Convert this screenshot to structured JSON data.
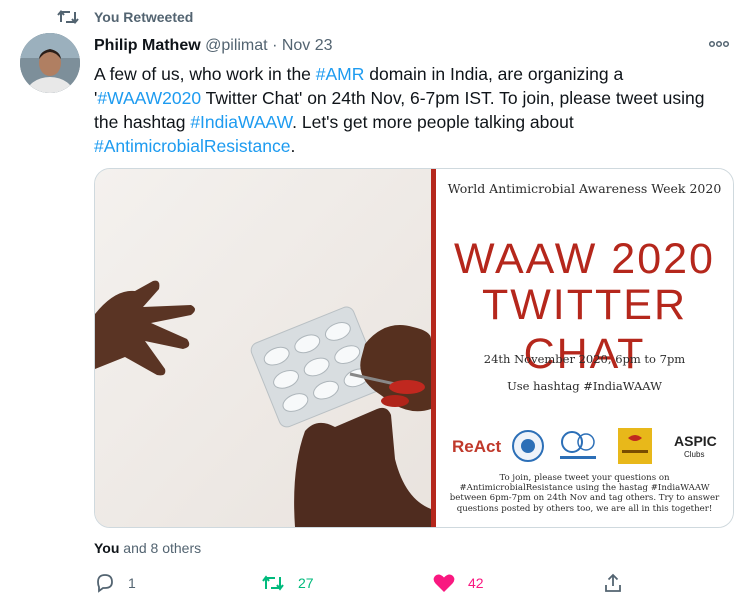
{
  "retweet_banner": {
    "icon": "retweet-icon",
    "label": "You Retweeted"
  },
  "tweet": {
    "author_name": "Philip Mathew",
    "handle": "@pilimat",
    "separator": "·",
    "date": "Nov 23",
    "text_parts": [
      {
        "text": "A few of us, who work in the ",
        "tag": false
      },
      {
        "text": "#AMR",
        "tag": true
      },
      {
        "text": " domain in India, are organizing a '",
        "tag": false
      },
      {
        "text": "#WAAW2020",
        "tag": true
      },
      {
        "text": " Twitter Chat' on 24th Nov, 6-7pm IST. To join, please tweet using the hashtag ",
        "tag": false
      },
      {
        "text": "#IndiaWAAW",
        "tag": true
      },
      {
        "text": ". Let's get more people talking about ",
        "tag": false
      },
      {
        "text": "#AntimicrobialResistance",
        "tag": true
      },
      {
        "text": ".",
        "tag": false
      }
    ]
  },
  "poster": {
    "title": "World Antimicrobial Awareness Week 2020",
    "big_line1": "WAAW 2020",
    "big_line2": "TWITTER CHAT",
    "date_line": "24th November 2020, 6pm to 7pm",
    "hashtag_line": "Use hashtag #IndiaWAAW",
    "logos": [
      {
        "name": "ReAct",
        "color": "#c0392b"
      },
      {
        "name": "e-Bug",
        "color": "#2c6fb7"
      },
      {
        "name": "Health & Hygiene",
        "color": "#2c6fb7"
      },
      {
        "name": "Biodiversity",
        "color": "#e8b81a"
      },
      {
        "name": "ASPIC",
        "color": "#222222"
      }
    ],
    "join_text": "To join, please tweet your questions on #AntimicrobialResistance using the hastag #IndiaWAAW between 6pm-7pm on 24th Nov and tag others. Try to answer questions posted by others too, we are all in this together!"
  },
  "social": {
    "likes_bold": "You",
    "likes_rest": " and 8 others"
  },
  "actions": {
    "reply": {
      "icon": "reply-icon",
      "count": "1"
    },
    "retweet": {
      "icon": "retweet-icon",
      "count": "27",
      "color": "#00ba7c"
    },
    "like": {
      "icon": "heart-icon",
      "count": "42",
      "color": "#f91880"
    },
    "share": {
      "icon": "share-icon"
    }
  },
  "colors": {
    "accent": "#1d9bf0",
    "poster_red": "#b5271c",
    "muted": "#536471"
  }
}
